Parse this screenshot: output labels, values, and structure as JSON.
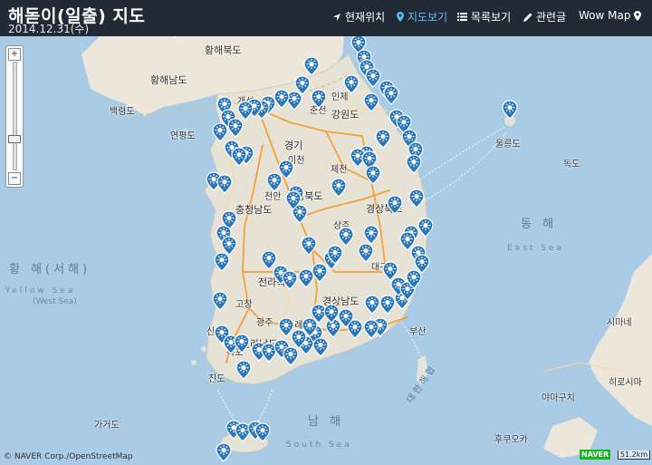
{
  "header": {
    "title": "해돋이(일출) 지도",
    "date": "2014.12.31(수)",
    "nav": [
      {
        "icon": "location-arrow-icon",
        "label": "현재위치",
        "active": false
      },
      {
        "icon": "map-marker-icon",
        "label": "지도보기",
        "active": true
      },
      {
        "icon": "list-icon",
        "label": "목록보기",
        "active": false
      },
      {
        "icon": "pencil-icon",
        "label": "관련글",
        "active": false
      },
      {
        "icon": "map-marker-icon",
        "label": "Wow Map",
        "active": false
      }
    ]
  },
  "map": {
    "colors": {
      "sea": "#a9cbe6",
      "land": "#e5e1d4",
      "road": "#f2a23b",
      "marker": "#2b77b8",
      "header": "#222b35"
    },
    "labels": {
      "hwanghae_bukdo": "황해북도",
      "hwanghae_namdo": "황해남도",
      "gaeseong": "개성",
      "baengnyeongdo": "백령도",
      "yeonpyeongdo": "연평도",
      "inje": "인제",
      "chuncheon": "춘천",
      "gangwondo": "강원도",
      "ulleungdo": "울릉도",
      "dokdo": "독도",
      "gyeonggido": "경기",
      "jecheon": "제천",
      "icheon": "이천",
      "chungcheongbukdo": "충청북도",
      "chungcheongnamdo": "충청남도",
      "cheonan": "천안",
      "sangju": "상주",
      "gyeongsangbukdo": "경상북도",
      "daegu": "대구",
      "jeollabukdo": "전라북도",
      "gyeongsangnamdo": "경상남도",
      "gochang": "고창",
      "gwangju": "광주",
      "gurye": "구례",
      "jeollanamdo": "전라남도",
      "sinan": "신안",
      "mokpo": "목포",
      "jindo": "진도",
      "busan": "부산",
      "gageodo": "가거도",
      "korea_strait": "대한해협",
      "tsushima": "시마네",
      "hirosima": "히로시마",
      "yamaguchi": "야마구치",
      "fukuoka": "후쿠오카"
    },
    "seas": {
      "east_ko": "동 해",
      "east_en": "East Sea",
      "yellow_ko": "황 해(서해)",
      "yellow_en": "Yellow Sea",
      "yellow_en2": "(West Sea)",
      "south_ko": "남 해",
      "south_en": "South Sea"
    },
    "attribution": "© NAVER Corp./OpenStreetMap",
    "naver_logo": "NAVER",
    "scale": "51.2km",
    "zoom_in": "+",
    "zoom_out": "−",
    "zoom_level_fraction": 0.71
  }
}
